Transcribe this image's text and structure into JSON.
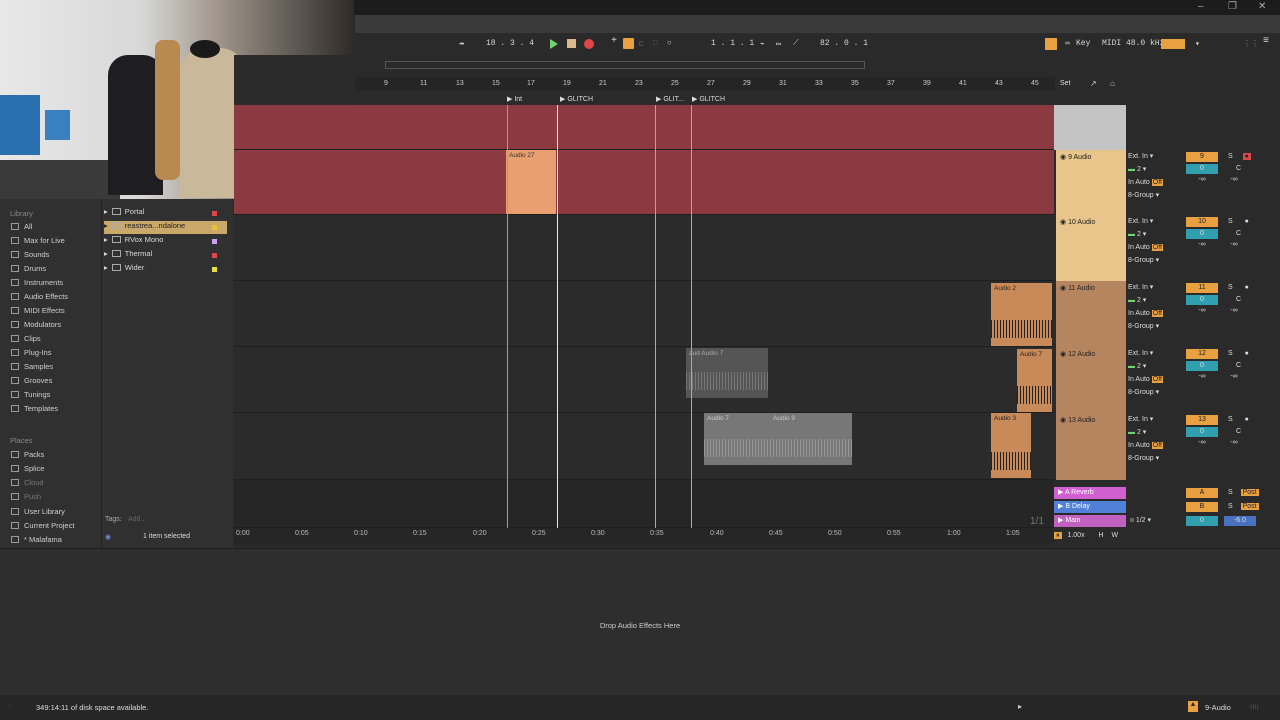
{
  "transport": {
    "tempo_icon": "metronome-icon",
    "position": "18 .  3 .  4",
    "loop_start": "1 .  1 .  1",
    "zoom": "82 .  0 .  1",
    "key_label": "Key",
    "midi_label": "MIDI",
    "sample_rate": "48.0 kHz"
  },
  "browser": {
    "library_heading": "Library",
    "library_items": [
      "All",
      "Max for Live",
      "Sounds",
      "Drums",
      "Instruments",
      "Audio Effects",
      "MIDI Effects",
      "Modulators",
      "Clips",
      "Plug-Ins",
      "Samples",
      "Grooves",
      "Tunings",
      "Templates"
    ],
    "places_heading": "Places",
    "places_items": [
      "Packs",
      "Splice",
      "Cloud",
      "Push",
      "User Library",
      "Current Project",
      "* Malafama"
    ],
    "plugins": [
      {
        "name": "Portal",
        "color": "#e0474a"
      },
      {
        "name": "reastrea...ndalone",
        "color": "#e8c040",
        "selected": true
      },
      {
        "name": "RVox Mono",
        "color": "#cfa0f0"
      },
      {
        "name": "Thermal",
        "color": "#e0474a"
      },
      {
        "name": "Wider",
        "color": "#e8e040"
      }
    ],
    "tags_label": "Tags:",
    "tags_placeholder": "Add...",
    "selection_status": "1 item selected"
  },
  "ruler": {
    "bars": [
      "9",
      "11",
      "13",
      "15",
      "17",
      "19",
      "21",
      "23",
      "25",
      "27",
      "29",
      "31",
      "33",
      "35",
      "37",
      "39",
      "41",
      "43",
      "45"
    ],
    "set_label": "Set"
  },
  "locators": [
    "Int",
    "GLITCH",
    "GLIT...",
    "GLITCH"
  ],
  "clips": {
    "audio27": "Audio 27",
    "audio2": "Audio 2",
    "audio7_track12": "Audio 7",
    "audio7_ghost": "aud Audio 7",
    "audio7_track13": "Audio 7",
    "audio9": "Audio 9",
    "audio3": "Audio 3"
  },
  "timeline": {
    "labels": [
      "0:00",
      "0:05",
      "0:10",
      "0:15",
      "0:20",
      "0:25",
      "0:30",
      "0:35",
      "0:40",
      "0:45",
      "0:50",
      "0:55",
      "1:00",
      "1:05"
    ],
    "page_indicator": "1/1"
  },
  "tracks": [
    {
      "name": "9 Audio",
      "input": "Ext. In",
      "channel": "2",
      "group": "8-Group",
      "number": "9",
      "vol": "0",
      "pan": "C",
      "armed": true
    },
    {
      "name": "10 Audio",
      "input": "Ext. In",
      "channel": "2",
      "group": "8-Group",
      "number": "10",
      "vol": "0",
      "pan": "C",
      "armed": false
    },
    {
      "name": "11 Audio",
      "input": "Ext. In",
      "channel": "2",
      "group": "8-Group",
      "number": "11",
      "vol": "0",
      "pan": "C",
      "armed": false
    },
    {
      "name": "12 Audio",
      "input": "Ext. In",
      "channel": "2",
      "group": "8-Group",
      "number": "12",
      "vol": "0",
      "pan": "C",
      "armed": false
    },
    {
      "name": "13 Audio",
      "input": "Ext. In",
      "channel": "2",
      "group": "8-Group",
      "number": "13",
      "vol": "0",
      "pan": "C",
      "armed": false
    }
  ],
  "monitor": {
    "in": "In",
    "auto": "Auto",
    "off": "Off",
    "solo": "S",
    "neg_inf": "-∞"
  },
  "returns": [
    {
      "name": "A Reverb",
      "letter": "A",
      "post": "Post",
      "color": "#e060e0"
    },
    {
      "name": "B Delay",
      "letter": "B",
      "post": "Post",
      "color": "#6aa0f0"
    },
    {
      "name": "Main",
      "letter": "",
      "post": "",
      "color": "#d070d0"
    }
  ],
  "main": {
    "cue": "1/2",
    "vol": "0",
    "gain": "-6.0"
  },
  "footer_controls": {
    "zoom": "1.00x",
    "h": "H",
    "w": "W"
  },
  "devices": {
    "drop_text": "Drop Audio Effects Here"
  },
  "status": {
    "disk_space": "349:14:11 of disk space available.",
    "selected_track": "9-Audio"
  }
}
